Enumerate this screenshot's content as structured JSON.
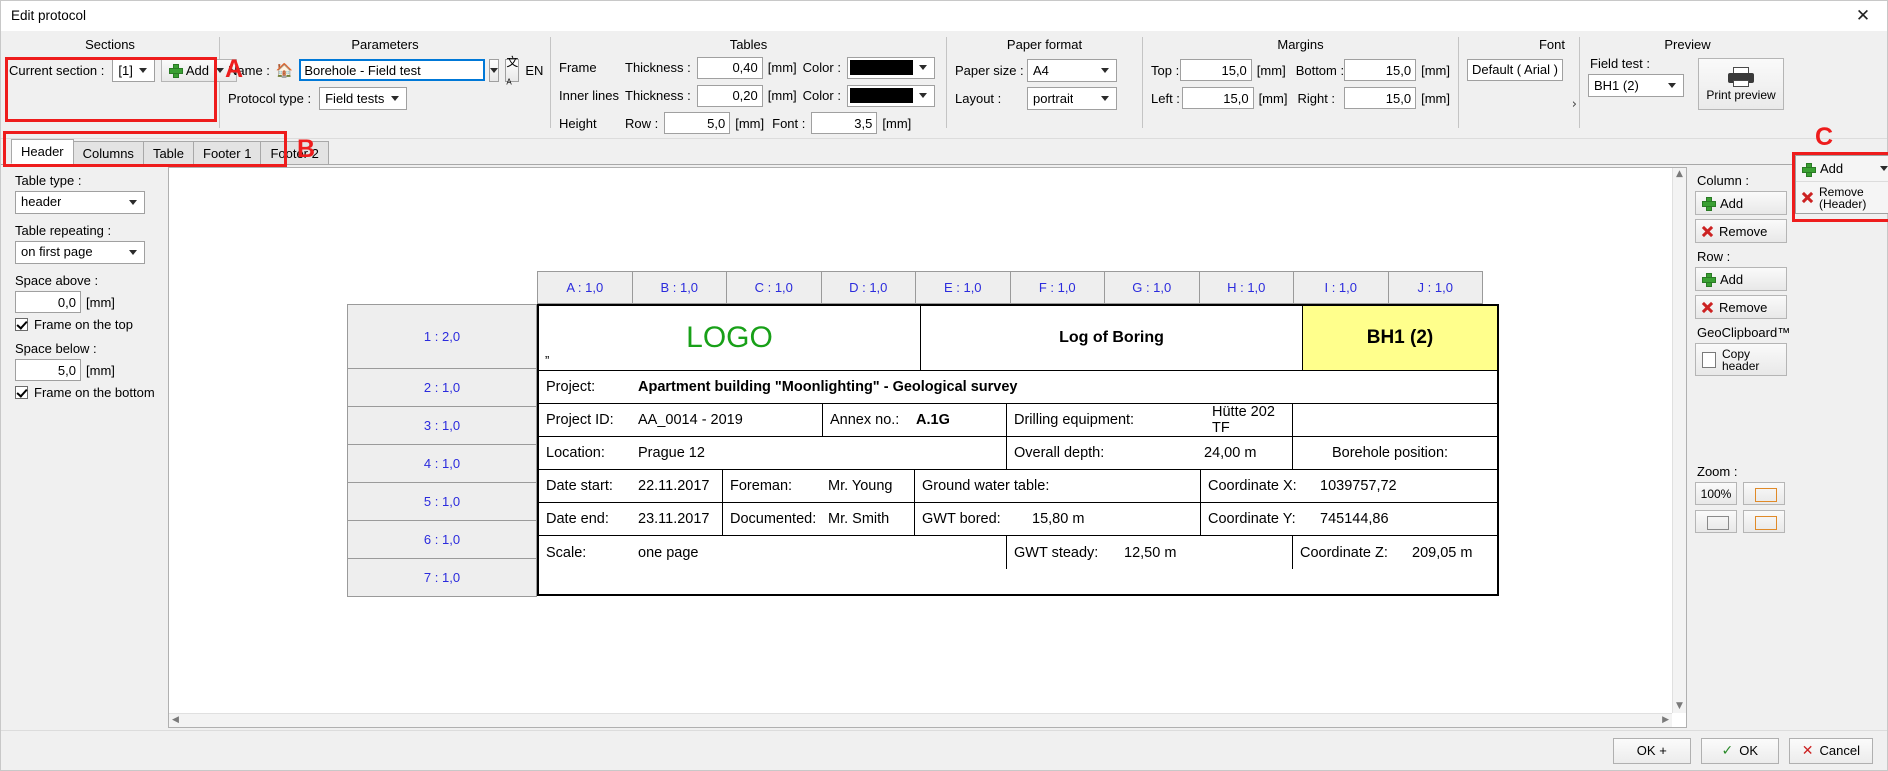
{
  "window": {
    "title": "Edit protocol",
    "close_icon": "close-icon",
    "close_glyph": "✕"
  },
  "toolbar": {
    "sections": {
      "group_title": "Sections",
      "current_section_label": "Current section :",
      "current_section_value": "[1]",
      "add_label": "Add"
    },
    "parameters": {
      "group_title": "Parameters",
      "name_label": "Name :",
      "home_icon": "house-icon",
      "name_value": "Borehole - Field test",
      "translate_icon": "translate-icon",
      "lang_label": "EN",
      "protocol_type_label": "Protocol type :",
      "protocol_type_value": "Field tests"
    },
    "tables": {
      "group_title": "Tables",
      "frame_label": "Frame",
      "frame_thickness_label": "Thickness :",
      "frame_thickness_value": "0,40",
      "frame_unit": "[mm]",
      "frame_color_label": "Color :",
      "frame_color": "#000000",
      "inner_label": "Inner lines",
      "inner_thickness_label": "Thickness :",
      "inner_thickness_value": "0,20",
      "inner_unit": "[mm]",
      "inner_color_label": "Color :",
      "inner_color": "#000000",
      "height_label": "Height",
      "row_label": "Row :",
      "row_value": "5,0",
      "row_unit": "[mm]",
      "font_label": "Font :",
      "font_value": "3,5",
      "font_unit": "[mm]"
    },
    "paper_format": {
      "group_title": "Paper format",
      "paper_size_label": "Paper size :",
      "paper_size_value": "A4",
      "layout_label": "Layout :",
      "layout_value": "portrait"
    },
    "margins": {
      "group_title": "Margins",
      "top_label": "Top :",
      "top_value": "15,0",
      "top_unit": "[mm]",
      "bottom_label": "Bottom :",
      "bottom_value": "15,0",
      "bottom_unit": "[mm]",
      "left_label": "Left :",
      "left_value": "15,0",
      "left_unit": "[mm]",
      "right_label": "Right :",
      "right_value": "15,0",
      "right_unit": "[mm]"
    },
    "font": {
      "group_title": "Font",
      "value": "Default ( Arial )",
      "expand_glyph": "›"
    },
    "preview": {
      "group_title": "Preview",
      "field_test_label": "Field test :",
      "field_test_value": "BH1 (2)",
      "print_preview_label": "Print preview",
      "printer_icon": "printer-icon"
    }
  },
  "annotations": [
    {
      "letter": "A"
    },
    {
      "letter": "B"
    },
    {
      "letter": "C"
    }
  ],
  "tabs": [
    {
      "label": "Header",
      "active": true
    },
    {
      "label": "Columns",
      "active": false
    },
    {
      "label": "Table",
      "active": false
    },
    {
      "label": "Footer 1",
      "active": false
    },
    {
      "label": "Footer 2",
      "active": false
    }
  ],
  "left_panel": {
    "table_type_label": "Table type :",
    "table_type_value": "header",
    "table_repeating_label": "Table repeating :",
    "table_repeating_value": "on first page",
    "space_above_label": "Space above :",
    "space_above_value": "0,0",
    "space_above_unit": "[mm]",
    "frame_top_label": "Frame on the top",
    "frame_top_checked": true,
    "space_below_label": "Space below :",
    "space_below_value": "5,0",
    "space_below_unit": "[mm]",
    "frame_bottom_label": "Frame on the bottom",
    "frame_bottom_checked": true
  },
  "right_panel": {
    "column_label": "Column :",
    "column_add": "Add",
    "column_remove": "Remove",
    "row_label": "Row :",
    "row_add": "Add",
    "row_remove": "Remove",
    "geoclipboard_label": "GeoClipboard™",
    "copy_header_line1": "Copy",
    "copy_header_line2": "header",
    "zoom_label": "Zoom :",
    "zoom_100": "100%",
    "popup": {
      "add_label": "Add",
      "remove_line1": "Remove",
      "remove_line2": "(Header)"
    }
  },
  "protocol": {
    "column_headers": [
      "A : 1,0",
      "B : 1,0",
      "C : 1,0",
      "D : 1,0",
      "E : 1,0",
      "F : 1,0",
      "G : 1,0",
      "H : 1,0",
      "I : 1,0",
      "J : 1,0"
    ],
    "row_headers": [
      "1 : 2,0",
      "2 : 1,0",
      "3 : 1,0",
      "4 : 1,0",
      "5 : 1,0",
      "6 : 1,0",
      "7 : 1,0"
    ],
    "logo_text": "LOGO",
    "logo_color": "#18a018",
    "quote_mark": "”",
    "title": "Log of Boring",
    "badge": "BH1 (2)",
    "badge_color": "#ffff8c",
    "project_label": "Project:",
    "project_value": "Apartment building \"Moonlighting\" - Geological survey",
    "project_id_label": "Project ID:",
    "project_id_value": "AA_0014 - 2019",
    "annex_label": "Annex no.:",
    "annex_value": "A.1G",
    "drilling_label": "Drilling equipment:",
    "drilling_value": "Hütte 202 TF",
    "location_label": "Location:",
    "location_value": "Prague 12",
    "overall_depth_label": "Overall depth:",
    "overall_depth_value": "24,00 m",
    "borehole_position_label": "Borehole position:",
    "date_start_label": "Date start:",
    "date_start_value": "22.11.2017",
    "foreman_label": "Foreman:",
    "foreman_value": "Mr. Young",
    "gwt_label": "Ground water table:",
    "coord_x_label": "Coordinate X:",
    "coord_x_value": "1039757,72",
    "date_end_label": "Date end:",
    "date_end_value": "23.11.2017",
    "documented_label": "Documented:",
    "documented_value": "Mr. Smith",
    "gwt_bored_label": "GWT bored:",
    "gwt_bored_value": "15,80 m",
    "coord_y_label": "Coordinate Y:",
    "coord_y_value": "745144,86",
    "scale_label": "Scale:",
    "scale_value": "one page",
    "gwt_steady_label": "GWT steady:",
    "gwt_steady_value": "12,50 m",
    "coord_z_label": "Coordinate Z:",
    "coord_z_value": "209,05 m"
  },
  "footer": {
    "ok_plus": "OK +",
    "ok": "OK",
    "cancel": "Cancel"
  }
}
